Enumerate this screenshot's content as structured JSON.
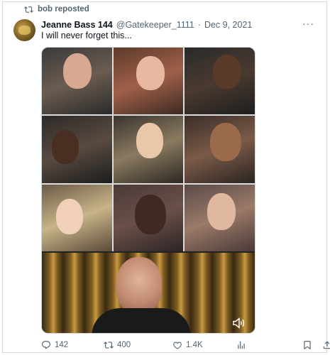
{
  "repost": {
    "text": "bob reposted"
  },
  "author": {
    "name": "Jeanne Bass 144",
    "handle": "@Gatekeeper_1111",
    "separator": "·",
    "date": "Dec 9, 2021"
  },
  "tweet": {
    "text": "I will never forget this..."
  },
  "more_label": "···",
  "stats": {
    "replies": "142",
    "reposts": "400",
    "likes": "1.4K"
  },
  "icons": {
    "repost": "repost-icon",
    "reply": "reply-icon",
    "like": "heart-icon",
    "views": "analytics-icon",
    "bookmark": "bookmark-icon",
    "share": "share-icon",
    "volume": "speaker-icon"
  },
  "colors": {
    "text": "#0f1419",
    "muted": "#536471",
    "border": "#cfd9de"
  }
}
